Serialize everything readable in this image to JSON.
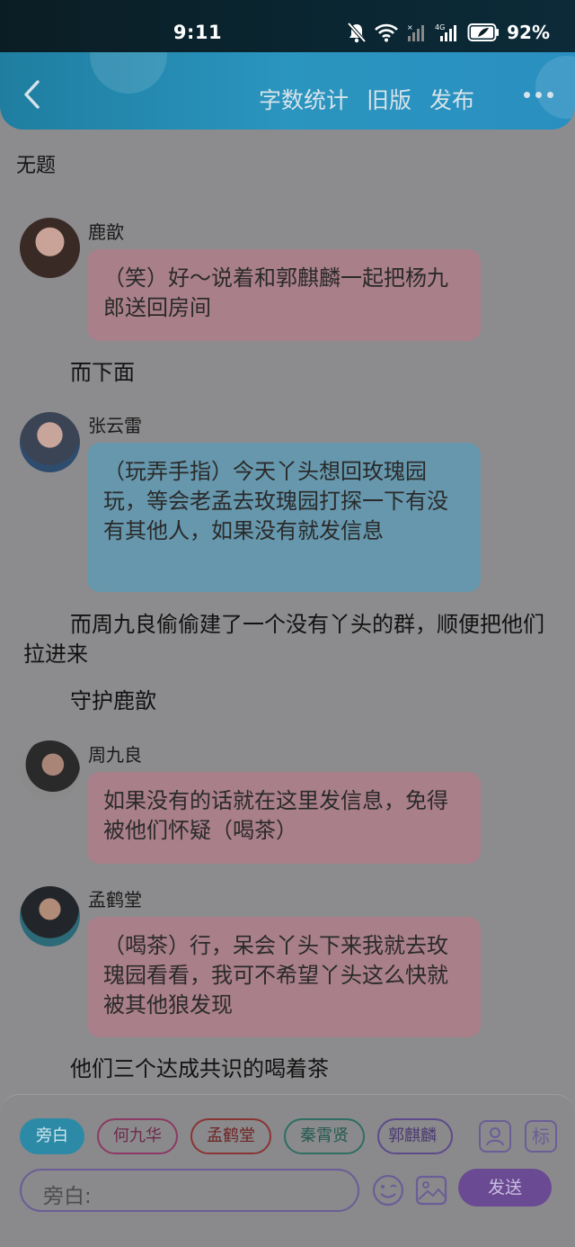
{
  "status_bar": {
    "time": "9:11",
    "battery": "92%"
  },
  "header": {
    "back_icon": "chevron-left-icon",
    "actions": [
      "字数统计",
      "旧版",
      "发布"
    ],
    "more_icon": "ellipsis-icon"
  },
  "doc_title": "无题",
  "entries": [
    {
      "kind": "dialogue",
      "speaker": "鹿歆",
      "text": "（笑）好～说着和郭麒麟一起把杨九郎送回房间",
      "color": "pink"
    },
    {
      "kind": "narration",
      "text": "而下面"
    },
    {
      "kind": "dialogue",
      "speaker": "张云雷",
      "text": "（玩弄手指）今天丫头想回玫瑰园玩，等会老孟去玫瑰园打探一下有没有其他人，如果没有就发信息",
      "color": "blue"
    },
    {
      "kind": "narration",
      "text": "而周九良偷偷建了一个没有丫头的群，顺便把他们拉进来"
    },
    {
      "kind": "narration",
      "text": "守护鹿歆"
    },
    {
      "kind": "dialogue",
      "speaker": "周九良",
      "text": "如果没有的话就在这里发信息，免得被他们怀疑（喝茶）",
      "color": "pink"
    },
    {
      "kind": "dialogue",
      "speaker": "孟鹤堂",
      "text": "（喝茶）行，呆会丫头下来我就去玫瑰园看看，我可不希望丫头这么快就被其他狼发现",
      "color": "pink"
    },
    {
      "kind": "narration",
      "text": "他们三个达成共识的喝着茶"
    }
  ],
  "composer": {
    "chips": [
      "旁白",
      "何九华",
      "孟鹤堂",
      "秦霄贤",
      "郭麒麟"
    ],
    "active_chip": "旁白",
    "role_icon": "person-card-icon",
    "tag_label": "标",
    "input_placeholder": "旁白:",
    "emoji_icon": "smiley-icon",
    "image_icon": "image-icon",
    "send_label": "发送"
  },
  "colors": {
    "header_blue": "#2a95bf",
    "pink_bubble": "#a97f8a",
    "blue_bubble": "#6697ac",
    "accent_purple": "#6a4a93"
  }
}
